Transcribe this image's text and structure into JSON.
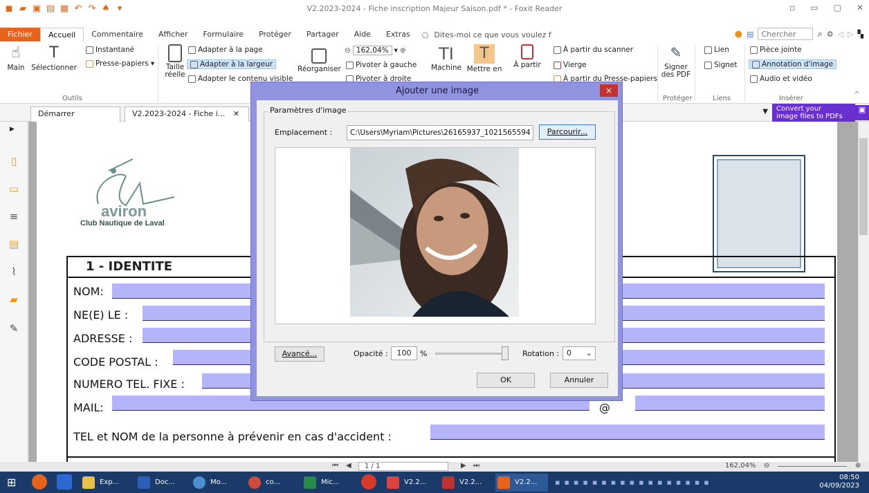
{
  "window": {
    "title": "V2.2023-2024 - Fiche inscription Majeur Saison.pdf * - Foxit Reader"
  },
  "tabs": [
    "Fichier",
    "Accueil",
    "Commentaire",
    "Afficher",
    "Formulaire",
    "Protéger",
    "Partager",
    "Aide",
    "Extras"
  ],
  "tellme": "Dites-moi ce que vous voulez f",
  "search_placeholder": "Chercher",
  "ribbon": {
    "main": "Main",
    "select": "Sélectionner",
    "snapshot": "Instantané",
    "clipboard": "Presse-papiers",
    "outils": "Outils",
    "taille1": "Taille",
    "taille2": "réelle",
    "fit_page": "Adapter à la page",
    "fit_width": "Adapter à la largeur",
    "fit_visible": "Adapter le contenu visible",
    "reorganize": "Réorganiser",
    "zoom": "162,04%",
    "rot_left": "Pivoter à gauche",
    "rot_right": "Pivoter à droite",
    "machine": "Machine",
    "mettre_en": "Mettre en",
    "a_partir": "À partir",
    "from_scanner": "À partir du scanner",
    "blank": "Vierge",
    "from_clipboard": "À partir du Presse-papiers",
    "sign1": "Signer",
    "sign2": "des PDF",
    "protect": "Protéger",
    "link": "Lien",
    "bookmark": "Signet",
    "links": "Liens",
    "attach": "Pièce jointe",
    "img_annot": "Annotation d'image",
    "audio_video": "Audio et vidéo",
    "insert": "Insérer"
  },
  "doctabs": {
    "start": "Démarrer",
    "doc": "V2.2023-2024 - Fiche i...",
    "convert1": "Convert your",
    "convert2": "image files to PDFs"
  },
  "logo": {
    "word": "aviron",
    "club": "Club Nautique de Laval"
  },
  "form": {
    "heading": "1 - IDENTITE",
    "nom": "NOM:",
    "ne_le": "NE(E) LE :",
    "adresse": "ADRESSE :",
    "cp": "CODE POSTAL :",
    "tel": "NUMERO TEL. FIXE :",
    "mail": "MAIL:",
    "at": "@",
    "urgence": "TEL et NOM de la personne à prévenir en cas d'accident :"
  },
  "dialog": {
    "title": "Ajouter une image",
    "close": "×",
    "legend": "Paramètres d'image",
    "location_label": "Emplacement :",
    "path": "C:\\Users\\Myriam\\Pictures\\26165937_1021565594",
    "browse": "Parcourir...",
    "advanced": "Avancé...",
    "opacity_label": "Opacité :",
    "opacity": "100",
    "percent": "%",
    "rotation_label": "Rotation :",
    "rotation": "0",
    "ok": "OK",
    "cancel": "Annuler"
  },
  "status": {
    "page": "1 / 1",
    "zoom": "162,04%"
  },
  "taskbar": {
    "items": [
      "Exp...",
      "Doc...",
      "Mo...",
      "co...",
      "Mic...",
      "V2.2...",
      "V2.2...",
      "V2.2..."
    ],
    "time": "08:50",
    "date": "04/09/2023"
  },
  "colors": {
    "accent": "#e8641b",
    "field": "#b4b4fa",
    "dialog_frame": "#8f93e0",
    "taskbar": "#1a3a6a"
  }
}
